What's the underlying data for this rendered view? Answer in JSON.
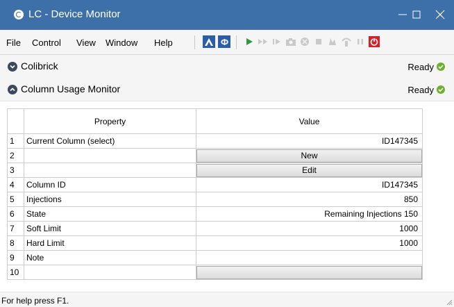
{
  "window": {
    "title": "LC - Device Monitor"
  },
  "menu": [
    "File",
    "Control",
    "View",
    "Window",
    "Help"
  ],
  "toolbar_icons": [
    "wizard-icon",
    "method-icon",
    "play-icon",
    "fast-forward-icon",
    "step-icon",
    "camera-icon",
    "abort-icon",
    "stop-icon",
    "acquire-icon",
    "purge-icon",
    "pause-icon",
    "power-icon"
  ],
  "sections": [
    {
      "title": "Colibrick",
      "status": "Ready"
    },
    {
      "title": "Column Usage Monitor",
      "status": "Ready"
    }
  ],
  "grid": {
    "headers": {
      "property": "Property",
      "value": "Value"
    },
    "rows": [
      {
        "num": "1",
        "property": "Current Column (select)",
        "value": "ID147345"
      },
      {
        "num": "2",
        "property": "",
        "button": "New"
      },
      {
        "num": "3",
        "property": "",
        "button": "Edit"
      },
      {
        "num": "4",
        "property": "Column ID",
        "value": "ID147345"
      },
      {
        "num": "5",
        "property": "Injections",
        "value": "850"
      },
      {
        "num": "6",
        "property": "State",
        "value": "Remaining Injections 150"
      },
      {
        "num": "7",
        "property": "Soft Limit",
        "value": "1000"
      },
      {
        "num": "8",
        "property": "Hard Limit",
        "value": "1000"
      },
      {
        "num": "9",
        "property": "Note",
        "value": ""
      },
      {
        "num": "10",
        "property": "",
        "button": ""
      }
    ]
  },
  "statusbar": {
    "text": "For help press F1."
  },
  "colors": {
    "titlebar": "#3d6fa9",
    "ready": "#6bb32e",
    "play": "#2e9a3a",
    "power": "#d2232a"
  }
}
